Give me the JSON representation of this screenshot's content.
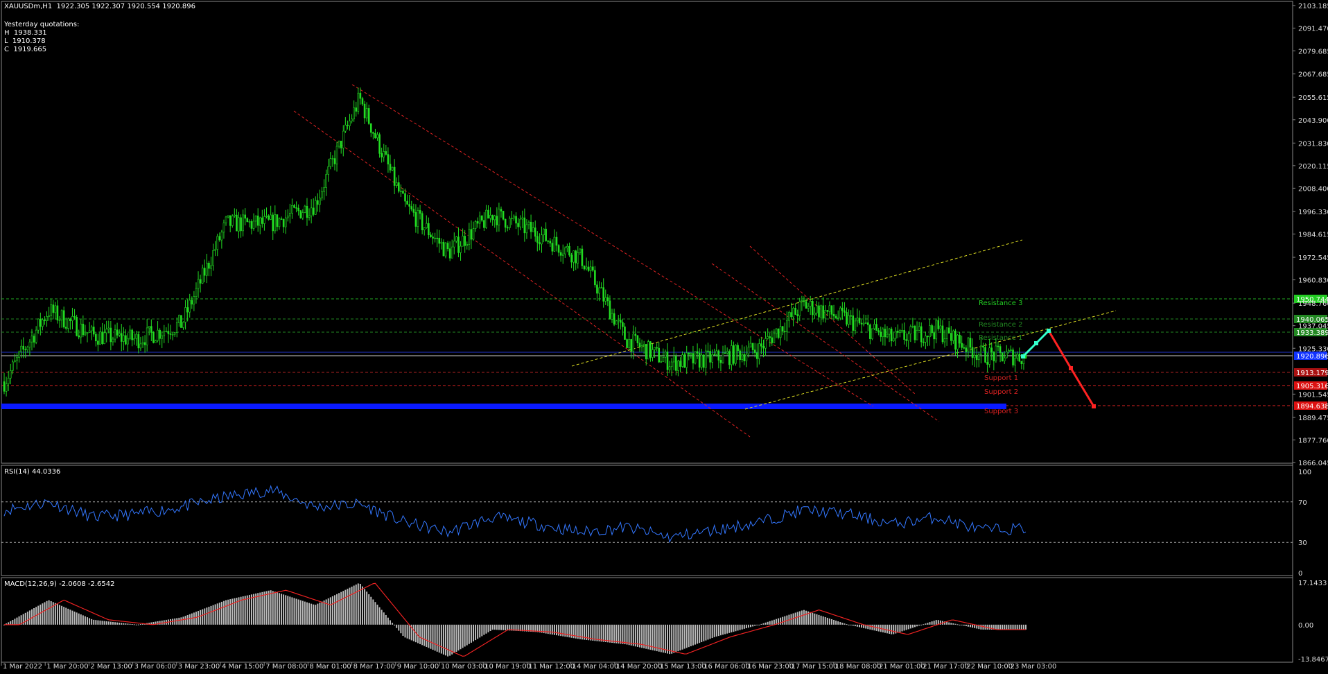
{
  "header": {
    "title_line": "XAUUSDm,H1  1922.305 1922.307 1920.554 1920.896",
    "yesterday_label": "Yesterday quotations:",
    "high": "H  1938.331",
    "low": "L  1910.378",
    "close": "C  1919.665"
  },
  "rsi": {
    "label": "RSI(14) 44.0336",
    "levels": [
      "100",
      "70",
      "30",
      "0"
    ]
  },
  "macd": {
    "label": "MACD(12,26,9) -2.0608 -2.6542",
    "levels": [
      "17.1433",
      "0.00",
      "-13.8467"
    ]
  },
  "price_axis_labels": [
    "2103.185",
    "2091.470",
    "2079.685",
    "2067.685",
    "2055.615",
    "2043.900",
    "2031.830",
    "2020.115",
    "2008.400",
    "1996.330",
    "1984.615",
    "1972.545",
    "1960.830",
    "1948.760",
    "1937.045",
    "1925.330",
    "1901.545",
    "1889.475",
    "1877.760",
    "1866.045"
  ],
  "level_tags": [
    {
      "text": "1950.744",
      "color": "#22cc22"
    },
    {
      "text": "1940.065",
      "color": "#228822"
    },
    {
      "text": "1933.389",
      "color": "#228822"
    },
    {
      "text": "1920.896",
      "color": "#1133ff"
    },
    {
      "text": "1913.179",
      "color": "#aa1111"
    },
    {
      "text": "1905.316",
      "color": "#dd1111"
    },
    {
      "text": "1894.638",
      "color": "#dd1111"
    }
  ],
  "level_labels": [
    "Resistance 3",
    "Resistance 2",
    "Resistance 1",
    "Support 1",
    "Support 2",
    "Support 3"
  ],
  "time_axis_labels": [
    "1 Mar 2022",
    "1 Mar 20:00",
    "2 Mar 13:00",
    "3 Mar 06:00",
    "3 Mar 23:00",
    "4 Mar 15:00",
    "7 Mar 08:00",
    "8 Mar 01:00",
    "8 Mar 17:00",
    "9 Mar 10:00",
    "10 Mar 03:00",
    "10 Mar 19:00",
    "11 Mar 12:00",
    "14 Mar 04:00",
    "14 Mar 20:00",
    "15 Mar 13:00",
    "16 Mar 06:00",
    "16 Mar 23:00",
    "17 Mar 15:00",
    "18 Mar 08:00",
    "21 Mar 01:00",
    "21 Mar 17:00",
    "22 Mar 10:00",
    "23 Mar 03:00"
  ],
  "chart_data": {
    "type": "line",
    "title": "XAUUSDm,H1",
    "x": [
      "1 Mar 2022",
      "1 Mar 20:00",
      "2 Mar 13:00",
      "3 Mar 06:00",
      "3 Mar 23:00",
      "4 Mar 15:00",
      "7 Mar 08:00",
      "8 Mar 01:00",
      "8 Mar 17:00",
      "9 Mar 10:00",
      "10 Mar 03:00",
      "10 Mar 19:00",
      "11 Mar 12:00",
      "14 Mar 04:00",
      "14 Mar 20:00",
      "15 Mar 13:00",
      "16 Mar 06:00",
      "16 Mar 23:00",
      "17 Mar 15:00",
      "18 Mar 08:00",
      "21 Mar 01:00",
      "21 Mar 17:00",
      "22 Mar 10:00",
      "23 Mar 03:00"
    ],
    "ylim": [
      1866.045,
      2103.185
    ],
    "series": [
      {
        "name": "XAUUSDm",
        "values": [
          1908,
          1945,
          1932,
          1930,
          1938,
          1990,
          1990,
          2000,
          2055,
          2000,
          1975,
          1995,
          1985,
          1972,
          1930,
          1918,
          1920,
          1925,
          1948,
          1940,
          1930,
          1935,
          1922,
          1921
        ]
      },
      {
        "name": "RSI(14)",
        "values": [
          62,
          70,
          55,
          58,
          65,
          75,
          82,
          65,
          68,
          50,
          40,
          55,
          48,
          40,
          45,
          35,
          42,
          50,
          62,
          58,
          48,
          55,
          42,
          44
        ]
      },
      {
        "name": "MACD",
        "values": [
          0,
          10,
          2,
          0,
          3,
          10,
          14,
          8,
          17,
          -5,
          -13,
          -2,
          -3,
          -6,
          -8,
          -12,
          -5,
          0,
          6,
          0,
          -4,
          2,
          -2,
          -2
        ]
      }
    ]
  }
}
